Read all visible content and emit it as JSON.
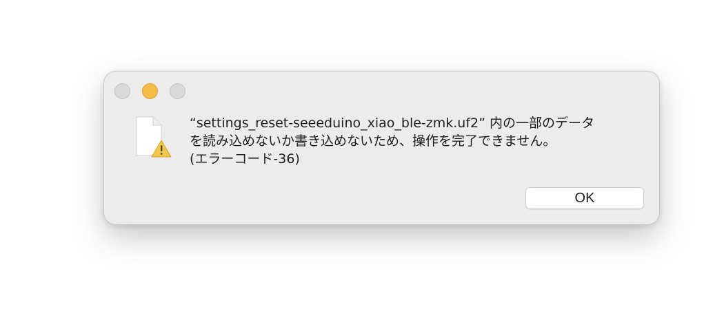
{
  "dialog": {
    "message": "“settings_reset-seeeduino_xiao_ble-zmk.uf2” 内の一部のデータ\nを読み込めないか書き込めないため、操作を完了できません。\n(エラーコード-36)",
    "ok_label": "OK",
    "icon": "document-warning-icon"
  },
  "window_controls": {
    "close": "close-button",
    "minimize": "minimize-button",
    "zoom": "zoom-button"
  },
  "colors": {
    "dialog_bg": "#ececec",
    "minimize": "#f5bc4a",
    "inactive_light": "#d9d9d9",
    "warning": "#f2c94c"
  }
}
